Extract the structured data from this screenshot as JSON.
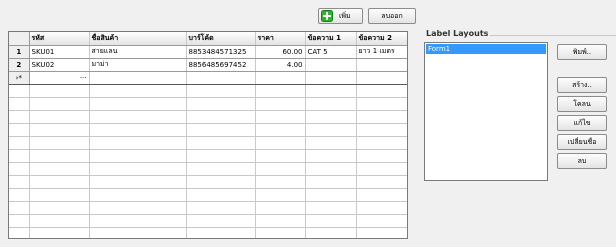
{
  "toolbar": {
    "add_label": "เพิ่ม",
    "delete_label": "ลบออก",
    "add_icon": "plus-icon",
    "add_icon_color": "#2db52d"
  },
  "grid": {
    "columns": [
      "รหัส",
      "ชื่อสินค้า",
      "บาร์โค้ด",
      "ราคา",
      "ข้อความ 1",
      "ข้อความ 2"
    ],
    "rows": [
      {
        "num": "1",
        "cells": [
          "SKU01",
          "สายแลน",
          "8853484571325",
          "60.00",
          "CAT 5",
          "ยาว 1 เมตร"
        ]
      },
      {
        "num": "2",
        "cells": [
          "SKU02",
          "มาม่า",
          "8856485697452",
          "4.00",
          "",
          ""
        ]
      }
    ],
    "new_row_marker": "›*",
    "new_row_ellipsis": "···"
  },
  "layouts": {
    "title": "Label Layouts",
    "items": [
      "Form1"
    ],
    "selection_color": "#3399ff"
  },
  "side_buttons": {
    "print": "พิมพ์..",
    "create": "สร้าง..",
    "clone": "โคลน",
    "edit": "แก้ไข",
    "rename": "เปลี่ยนชื่อ",
    "delete": "ลบ"
  }
}
